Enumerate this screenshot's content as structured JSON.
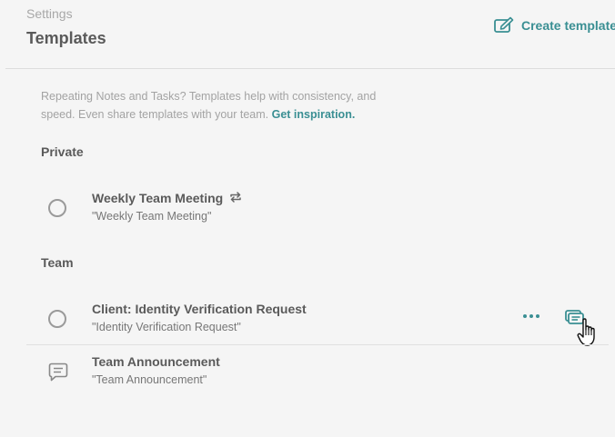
{
  "header": {
    "breadcrumb": "Settings",
    "title": "Templates",
    "create_label": "Create template"
  },
  "intro": {
    "text": "Repeating Notes and Tasks? Templates help with consistency, and speed. Even share templates with your team.",
    "link": "Get inspiration."
  },
  "sections": {
    "private": {
      "label": "Private",
      "items": [
        {
          "name": "Weekly Team Meeting",
          "subtitle": "\"Weekly Team Meeting\"",
          "type": "task",
          "recurring": true
        }
      ]
    },
    "team": {
      "label": "Team",
      "items": [
        {
          "name": "Client: Identity Verification Request",
          "subtitle": "\"Identity Verification Request\"",
          "type": "task"
        },
        {
          "name": "Team Announcement",
          "subtitle": "\"Team Announcement\"",
          "type": "note"
        }
      ]
    }
  },
  "colors": {
    "accent": "#3a8f93",
    "background": "#f5f5f5",
    "text": "#5a5a5a",
    "muted": "#a3a3a3"
  },
  "icons": {
    "create": "edit-square-icon",
    "recurring": "repeat-icon",
    "task": "radio-circle-icon",
    "note": "message-icon",
    "more": "more-dots-icon",
    "use": "copy-template-icon"
  }
}
